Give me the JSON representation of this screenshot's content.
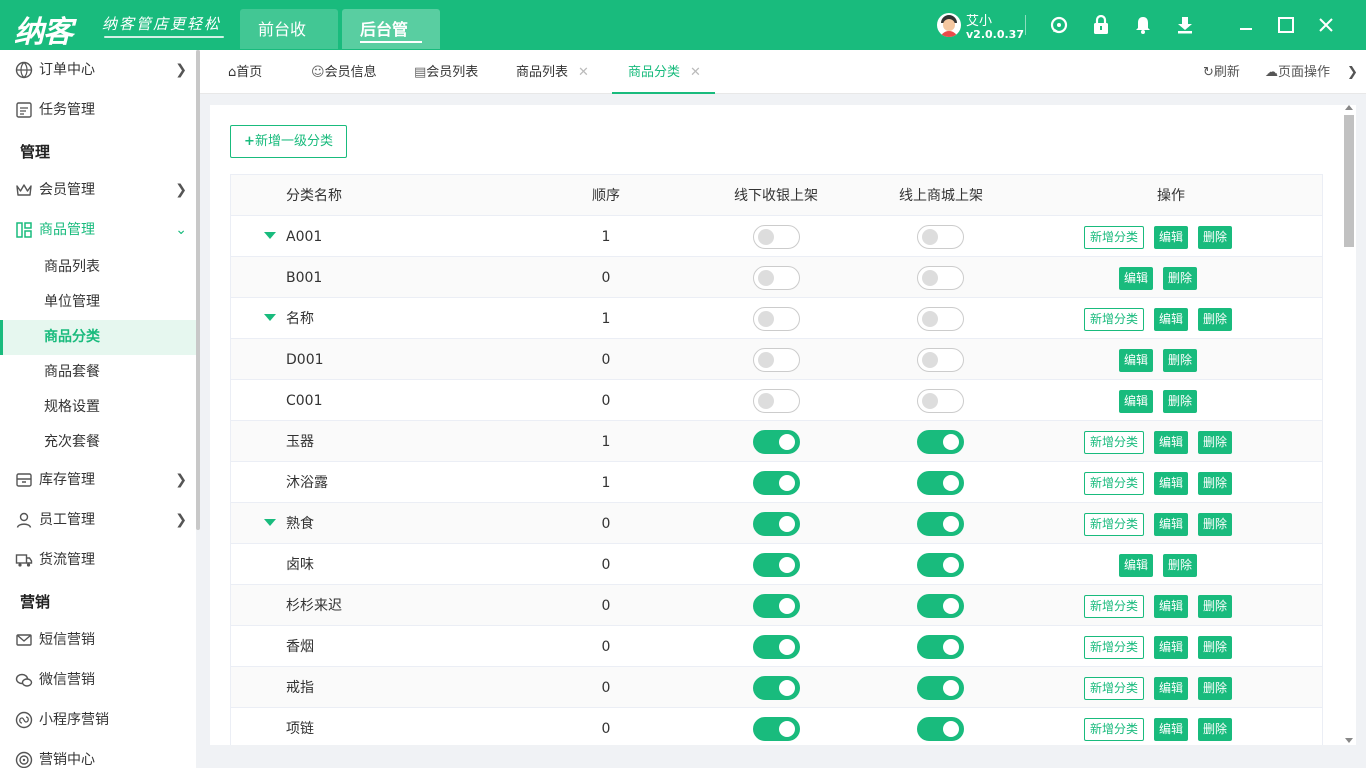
{
  "header": {
    "logo": "纳客",
    "slogan": "纳客管店更轻松",
    "tabs": [
      "前台收银",
      "后台管理"
    ],
    "user_name": "艾小",
    "version": "v2.0.0.37",
    "icons": [
      "support-icon",
      "lock-icon",
      "bell-icon",
      "download-icon",
      "minimize-icon",
      "maximize-icon",
      "close-icon"
    ]
  },
  "sidebar": {
    "items": [
      {
        "label": "订单中心"
      },
      {
        "label": "任务管理"
      },
      {
        "section": "管理"
      },
      {
        "label": "会员管理"
      },
      {
        "label": "商品管理"
      },
      {
        "label": "库存管理"
      },
      {
        "label": "员工管理"
      },
      {
        "label": "货流管理"
      },
      {
        "section": "营销"
      },
      {
        "label": "短信营销"
      },
      {
        "label": "微信营销"
      },
      {
        "label": "小程序营销"
      },
      {
        "label": "营销中心"
      }
    ],
    "goods_sub": [
      "商品列表",
      "单位管理",
      "商品分类",
      "商品套餐",
      "规格设置",
      "充次套餐"
    ]
  },
  "tabs": {
    "items": [
      "首页",
      "会员信息",
      "会员列表",
      "商品列表",
      "商品分类"
    ],
    "close": "✕",
    "refresh": "刷新",
    "page_ops": "页面操作"
  },
  "page": {
    "add_button": "新增一级分类",
    "columns": [
      "分类名称",
      "顺序",
      "线下收银上架",
      "线上商城上架",
      "操作"
    ],
    "op_labels": {
      "add": "新增分类",
      "edit": "编辑",
      "delete": "删除"
    },
    "rows": [
      {
        "name": "A001",
        "order": "1",
        "expand": true,
        "offline": false,
        "online": false,
        "add": true
      },
      {
        "name": "B001",
        "order": "0",
        "expand": false,
        "offline": false,
        "online": false,
        "add": false
      },
      {
        "name": "名称",
        "order": "1",
        "expand": true,
        "offline": false,
        "online": false,
        "add": true
      },
      {
        "name": "D001",
        "order": "0",
        "expand": false,
        "offline": false,
        "online": false,
        "add": false
      },
      {
        "name": "C001",
        "order": "0",
        "expand": false,
        "offline": false,
        "online": false,
        "add": false
      },
      {
        "name": "玉器",
        "order": "1",
        "expand": false,
        "offline": true,
        "online": true,
        "add": true
      },
      {
        "name": "沐浴露",
        "order": "1",
        "expand": false,
        "offline": true,
        "online": true,
        "add": true
      },
      {
        "name": "熟食",
        "order": "0",
        "expand": true,
        "offline": true,
        "online": true,
        "add": true
      },
      {
        "name": "卤味",
        "order": "0",
        "expand": false,
        "offline": true,
        "online": true,
        "add": false
      },
      {
        "name": "杉杉来迟",
        "order": "0",
        "expand": false,
        "offline": true,
        "online": true,
        "add": true
      },
      {
        "name": "香烟",
        "order": "0",
        "expand": false,
        "offline": true,
        "online": true,
        "add": true
      },
      {
        "name": "戒指",
        "order": "0",
        "expand": false,
        "offline": true,
        "online": true,
        "add": true
      },
      {
        "name": "项链",
        "order": "0",
        "expand": false,
        "offline": true,
        "online": true,
        "add": true
      }
    ]
  },
  "colors": {
    "brand": "#19bb7d",
    "brand_light": "#e6f7ef"
  }
}
